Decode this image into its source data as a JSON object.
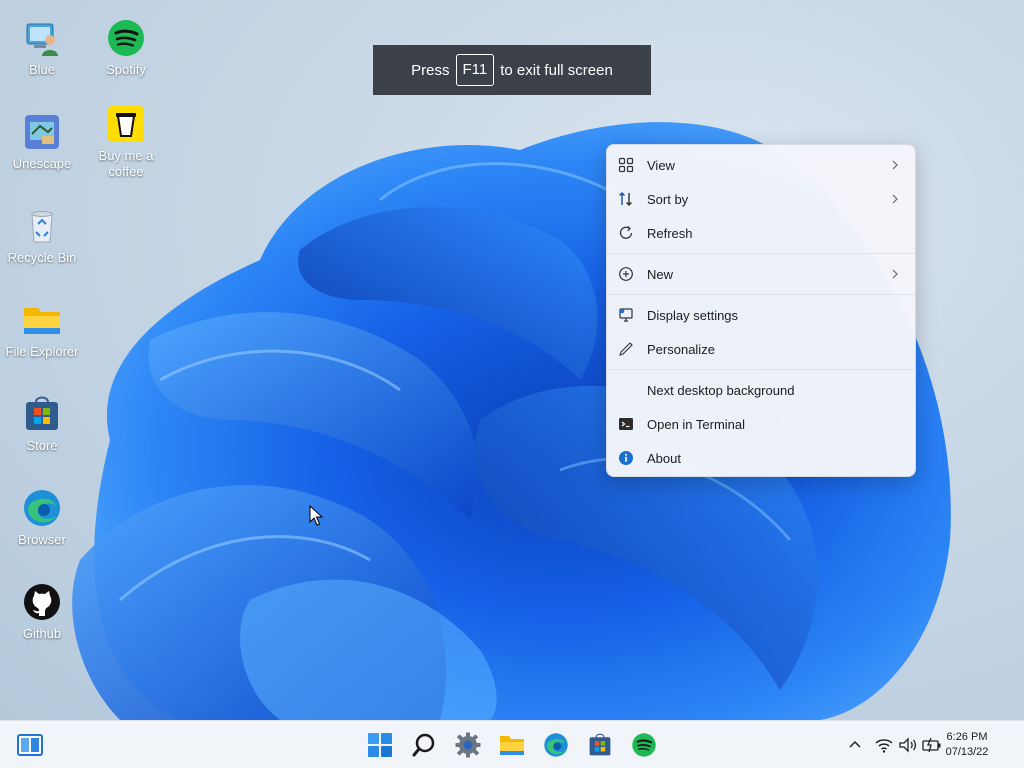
{
  "desktop_icons": [
    {
      "label": "Blue",
      "icon": "monitor-user-icon"
    },
    {
      "label": "Spotify",
      "icon": "spotify-icon"
    },
    {
      "label": "Unescape",
      "icon": "unescape-icon"
    },
    {
      "label": "Buy me a coffee",
      "icon": "coffee-cup-icon"
    },
    {
      "label": "Recycle Bin",
      "icon": "recycle-bin-icon"
    },
    {
      "label": "File Explorer",
      "icon": "folder-icon"
    },
    {
      "label": "Store",
      "icon": "store-icon"
    },
    {
      "label": "Browser",
      "icon": "edge-icon"
    },
    {
      "label": "Github",
      "icon": "github-icon"
    }
  ],
  "fullscreen_hint": {
    "prefix": "Press",
    "key": "F11",
    "suffix": "to exit full screen"
  },
  "context_menu": {
    "items": [
      {
        "label": "View",
        "icon": "grid-icon",
        "submenu": true
      },
      {
        "label": "Sort by",
        "icon": "sort-arrows-icon",
        "submenu": true
      },
      {
        "label": "Refresh",
        "icon": "refresh-icon",
        "submenu": false
      },
      {
        "label": "New",
        "icon": "plus-circle-icon",
        "submenu": true
      },
      {
        "label": "Display settings",
        "icon": "display-icon",
        "submenu": false
      },
      {
        "label": "Personalize",
        "icon": "pen-icon",
        "submenu": false
      },
      {
        "label": "Next desktop background",
        "icon": "",
        "submenu": false
      },
      {
        "label": "Open in Terminal",
        "icon": "terminal-icon",
        "submenu": false
      },
      {
        "label": "About",
        "icon": "info-icon",
        "submenu": false
      }
    ]
  },
  "taskbar": {
    "apps": [
      "start-icon",
      "search-icon",
      "settings-gear-icon",
      "file-explorer-icon",
      "edge-icon",
      "store-icon",
      "spotify-icon"
    ],
    "tray": [
      "chevron-up-icon",
      "wifi-icon",
      "volume-icon",
      "battery-icon"
    ],
    "time": "6:26 PM",
    "date": "07/13/22"
  },
  "colors": {
    "accent": "#0067c0",
    "spotify": "#1db954",
    "hint_bg": "#3c4149"
  }
}
